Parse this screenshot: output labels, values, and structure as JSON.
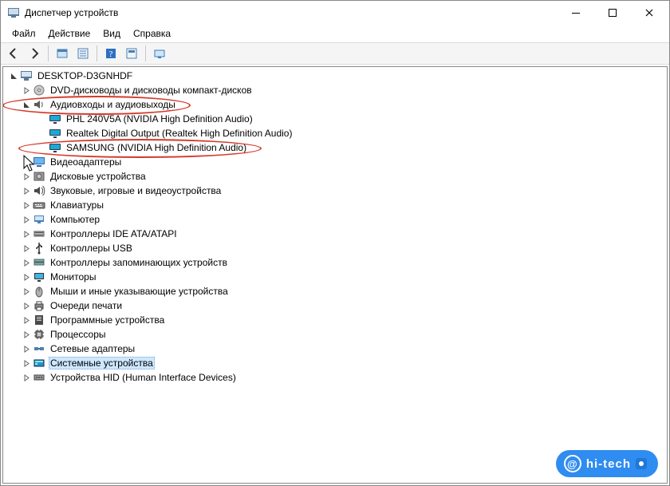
{
  "window": {
    "title": "Диспетчер устройств"
  },
  "menu": {
    "file": "Файл",
    "action": "Действие",
    "view": "Вид",
    "help": "Справка"
  },
  "toolbar_icons": {
    "back": "back-arrow-icon",
    "forward": "forward-arrow-icon",
    "show_hidden": "show-hidden-icon",
    "properties": "properties-icon",
    "help": "help-icon",
    "refresh": "refresh-icon",
    "scan": "scan-icon"
  },
  "tree": {
    "root": "DESKTOP-D3GNHDF",
    "categories": [
      {
        "label": "DVD-дисководы и дисководы компакт-дисков",
        "expanded": false,
        "icon": "disc"
      },
      {
        "label": "Аудиовходы и аудиовыходы",
        "expanded": true,
        "icon": "speaker",
        "highlight": true,
        "children": [
          {
            "label": "PHL 240V5A (NVIDIA High Definition Audio)",
            "icon": "monitor"
          },
          {
            "label": "Realtek Digital Output (Realtek High Definition Audio)",
            "icon": "monitor"
          },
          {
            "label": "SAMSUNG (NVIDIA High Definition Audio)",
            "icon": "monitor",
            "highlight": true
          }
        ]
      },
      {
        "label": "Видеоадаптеры",
        "expanded": false,
        "icon": "display"
      },
      {
        "label": "Дисковые устройства",
        "expanded": false,
        "icon": "hdd"
      },
      {
        "label": "Звуковые, игровые и видеоустройства",
        "expanded": false,
        "icon": "sound"
      },
      {
        "label": "Клавиатуры",
        "expanded": false,
        "icon": "keyboard"
      },
      {
        "label": "Компьютер",
        "expanded": false,
        "icon": "computer"
      },
      {
        "label": "Контроллеры IDE ATA/ATAPI",
        "expanded": false,
        "icon": "ide"
      },
      {
        "label": "Контроллеры USB",
        "expanded": false,
        "icon": "usb"
      },
      {
        "label": "Контроллеры запоминающих устройств",
        "expanded": false,
        "icon": "storage"
      },
      {
        "label": "Мониторы",
        "expanded": false,
        "icon": "monitor2"
      },
      {
        "label": "Мыши и иные указывающие устройства",
        "expanded": false,
        "icon": "mouse"
      },
      {
        "label": "Очереди печати",
        "expanded": false,
        "icon": "printer"
      },
      {
        "label": "Программные устройства",
        "expanded": false,
        "icon": "software"
      },
      {
        "label": "Процессоры",
        "expanded": false,
        "icon": "cpu"
      },
      {
        "label": "Сетевые адаптеры",
        "expanded": false,
        "icon": "network"
      },
      {
        "label": "Системные устройства",
        "expanded": false,
        "icon": "system",
        "selected": true
      },
      {
        "label": "Устройства HID (Human Interface Devices)",
        "expanded": false,
        "icon": "hid"
      }
    ]
  },
  "watermark": {
    "brand": "hi-tech",
    "at": "@"
  }
}
